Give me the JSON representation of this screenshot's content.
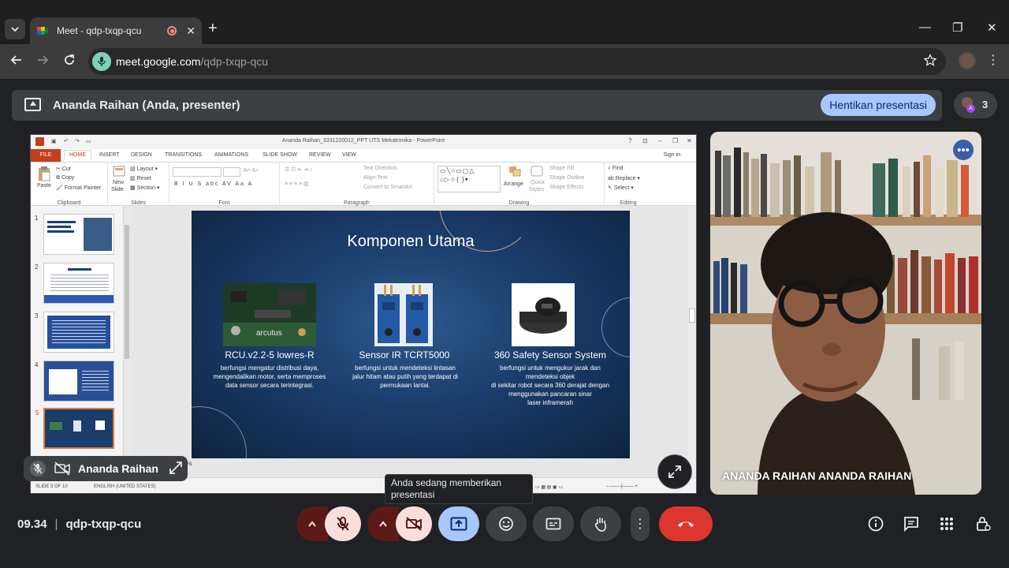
{
  "browser": {
    "tab_title": "Meet - qdp-txqp-qcu",
    "url_host": "meet.google.com",
    "url_path": "/qdp-txqp-qcu",
    "tab_close": "✕",
    "new_tab": "+",
    "minimize": "—",
    "restore": "❐",
    "close": "✕"
  },
  "presentation_bar": {
    "label": "Ananda Raihan (Anda, presenter)",
    "stop_button": "Hentikan presentasi",
    "participant_count": "3",
    "avatar_letter": "A"
  },
  "powerpoint": {
    "window_title": "Ananda Raihan_3331220012_PPT UTS Mekatronika - PowerPoint",
    "win_controls": [
      "?",
      "⊡",
      "–",
      "❐",
      "✕"
    ],
    "sign_in": "Sign in",
    "tabs": [
      "FILE",
      "HOME",
      "INSERT",
      "DESIGN",
      "TRANSITIONS",
      "ANIMATIONS",
      "SLIDE SHOW",
      "REVIEW",
      "VIEW"
    ],
    "groups": {
      "clipboard": {
        "name": "Clipboard",
        "paste": "Paste",
        "cut": "Cut",
        "copy": "Copy",
        "format_painter": "Format Painter"
      },
      "slides": {
        "name": "Slides",
        "new_slide_1": "New",
        "new_slide_2": "Slide",
        "layout": "Layout",
        "reset": "Reset",
        "section": "Section"
      },
      "font": {
        "name": "Font",
        "buttons": "B  I  U  S  abc  AV  Aa  A"
      },
      "paragraph": {
        "name": "Paragraph",
        "text_direction": "Text Direction",
        "align_text": "Align Text",
        "convert": "Convert to SmartArt"
      },
      "drawing": {
        "name": "Drawing",
        "arrange": "Arrange",
        "quick_styles_1": "Quick",
        "quick_styles_2": "Styles",
        "shape_fill": "Shape Fill",
        "shape_outline": "Shape Outline",
        "shape_effects": "Shape Effects"
      },
      "editing": {
        "name": "Editing",
        "find": "Find",
        "replace": "Replace",
        "select": "Select"
      }
    },
    "thumb_numbers": [
      "1",
      "2",
      "3",
      "4",
      "5"
    ],
    "slide": {
      "title": "Komponen Utama",
      "components": [
        {
          "name": "RCU.v2.2-5 lowres-R",
          "desc_1": "berfungsi mengatur distribusi daya,",
          "desc_2": "mengendalikan motor, serta memproses",
          "desc_3": "data sensor secara terintegrasi.",
          "desc_4": ""
        },
        {
          "name": "Sensor IR TCRT5000",
          "desc_1": "berfungsi untuk mendeteksi lintasan",
          "desc_2": "jalur hitam atau putih yang terdapat di",
          "desc_3": "permukaan lantai.",
          "desc_4": ""
        },
        {
          "name": "360 Safety Sensor System",
          "desc_1": "berfungsi untuk mengukur jarak dan",
          "desc_2": "mendeteksi objek",
          "desc_3": "di sekitar robot secara 360 derajat dengan",
          "desc_4": "menggunakan pancaran sinar",
          "desc_5": "laser inframerah"
        }
      ]
    },
    "notes_fragment": "es",
    "status_slide": "SLIDE 5 OF 10",
    "status_lang": "ENGLISH (UNITED STATES)"
  },
  "self_view": {
    "name": "Ananda Raihan"
  },
  "participant": {
    "name": "ANANDA RAIHAN ANANDA RAIHAN",
    "more": "•••"
  },
  "tooltip": {
    "text": "Anda sedang memberikan presentasi"
  },
  "meeting": {
    "time": "09.34",
    "separator": "|",
    "code": "qdp-txqp-qcu"
  },
  "colors": {
    "leave": "#dc362e",
    "present_active": "#a8c7fa",
    "muted_bg": "#f9dedc",
    "muted_caret": "#5c1a17",
    "ppt_accent": "#c43e1c"
  }
}
